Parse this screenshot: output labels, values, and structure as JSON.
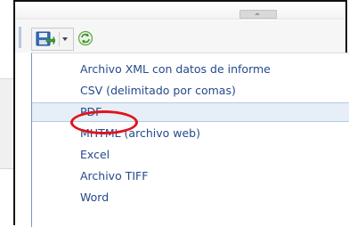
{
  "toolbar": {
    "export_icon": "save-disk-icon",
    "refresh_icon": "refresh-icon"
  },
  "menu": {
    "items": [
      {
        "label": "Archivo XML con datos de informe"
      },
      {
        "label": "CSV (delimitado por comas)"
      },
      {
        "label": "PDF"
      },
      {
        "label": "MHTML (archivo web)"
      },
      {
        "label": "Excel"
      },
      {
        "label": "Archivo TIFF"
      },
      {
        "label": "Word"
      }
    ],
    "selected_index": 2,
    "annotation_color": "#e0141c"
  }
}
